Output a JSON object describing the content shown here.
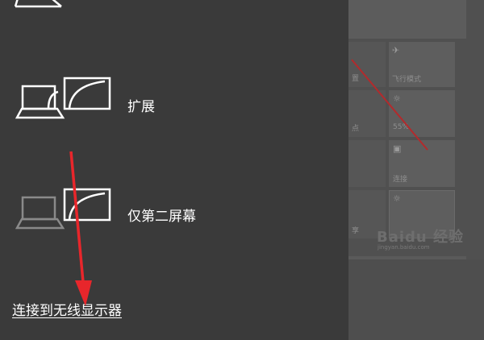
{
  "panel": {
    "options": [
      {
        "label": "扩展",
        "icon": "extend-icon"
      },
      {
        "label": "仅第二屏幕",
        "icon": "second-screen-only-icon"
      }
    ],
    "wireless_link": "连接到无线显示器"
  },
  "backdrop": {
    "tiles": [
      {
        "label": "飞行模式",
        "icon": "airplane-icon"
      },
      {
        "label": "55%",
        "icon": "brightness-icon"
      },
      {
        "label": "连接",
        "icon": "connect-icon"
      }
    ],
    "partial_labels": [
      "置",
      "点",
      "享"
    ],
    "watermark": "Baidu 经验",
    "watermark_sub": "jingyan.baidu.com"
  },
  "colors": {
    "panel_bg": "#3a3a3a",
    "backdrop_bg": "#505050",
    "annotation": "#e8262b"
  }
}
